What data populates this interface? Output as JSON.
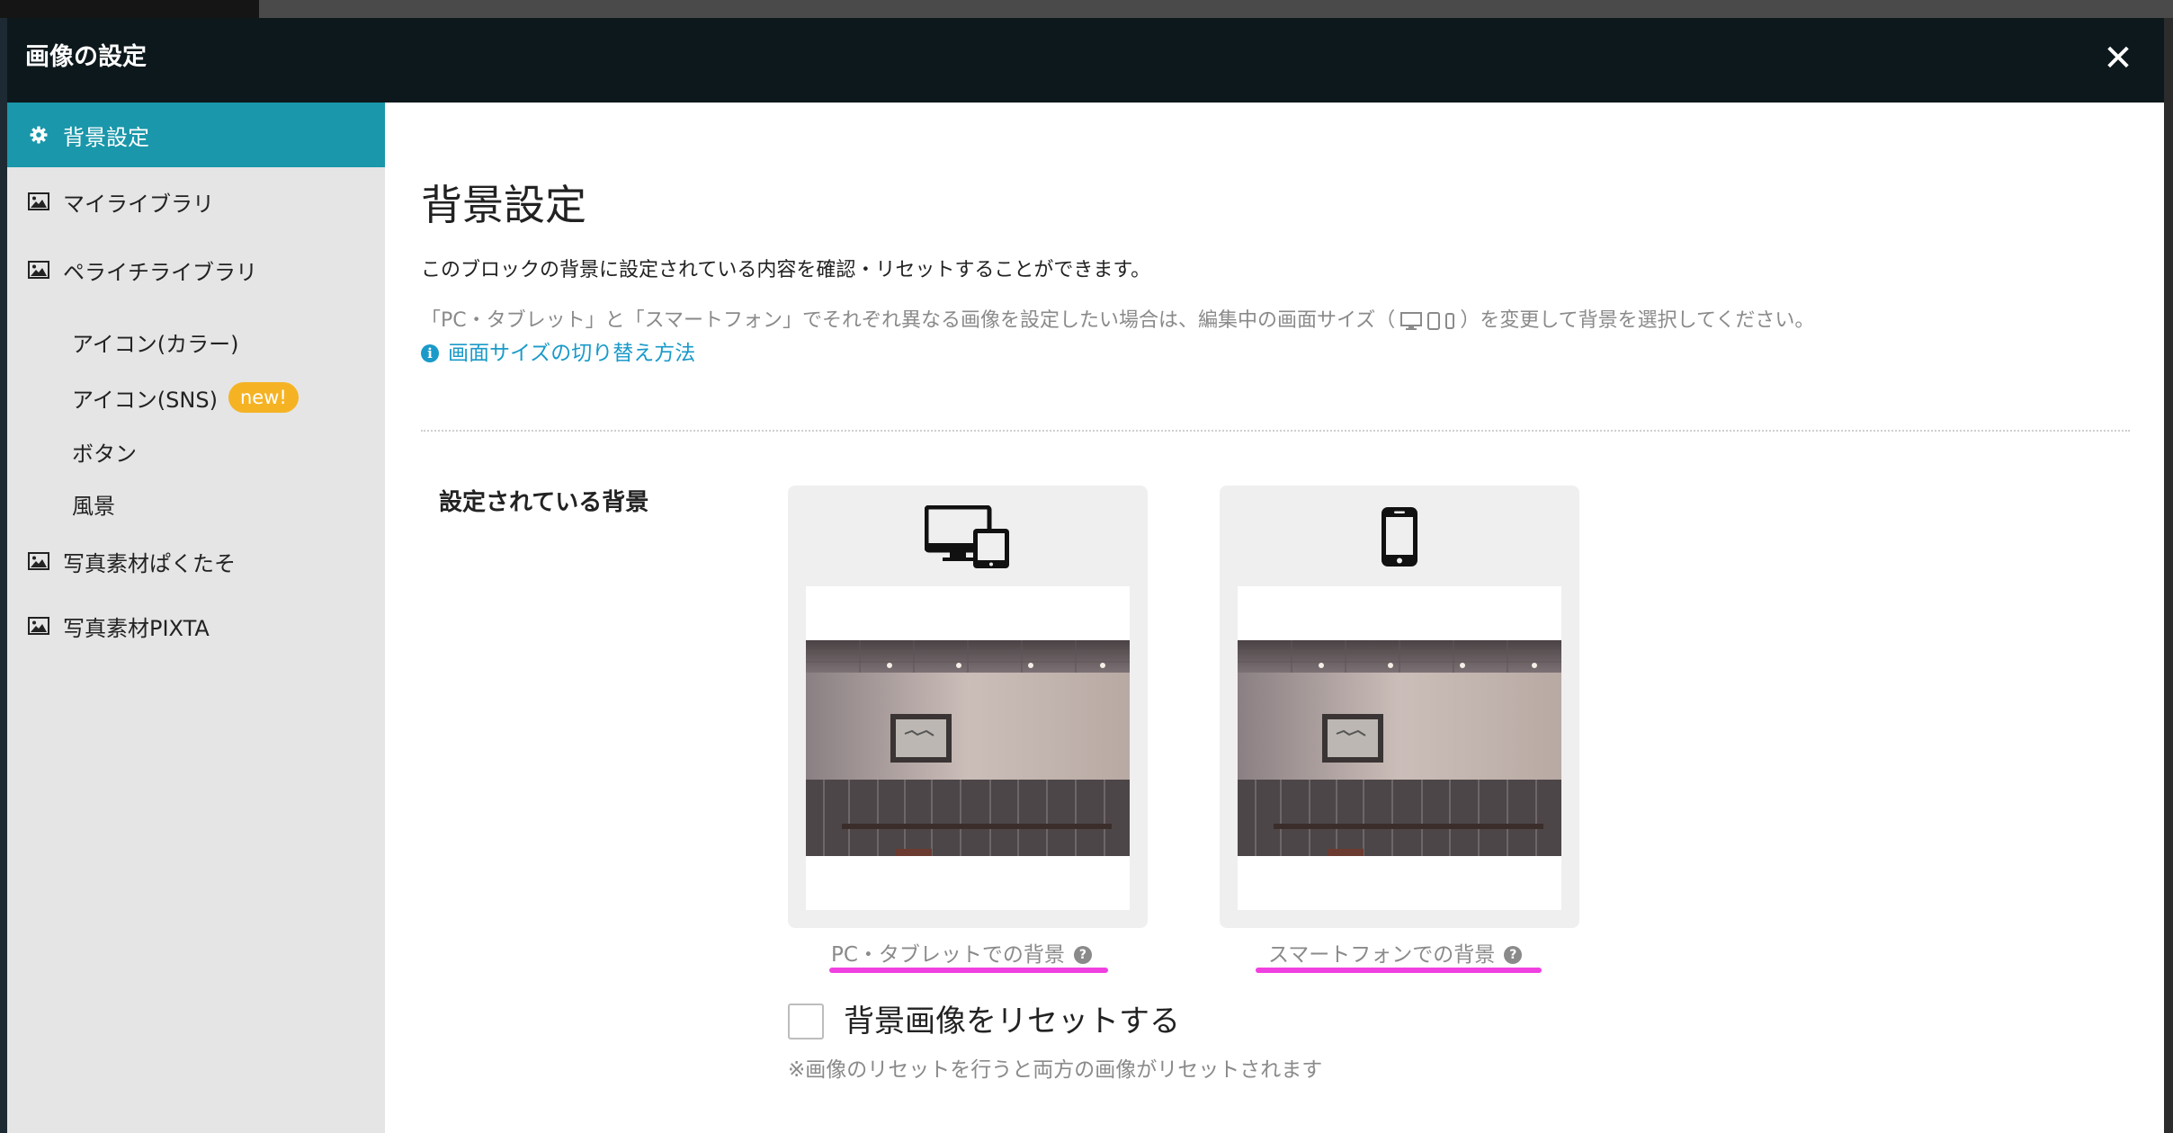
{
  "modal": {
    "title": "画像の設定",
    "close_label": "✕"
  },
  "sidebar": {
    "items": [
      {
        "label": "背景設定",
        "icon": "gear-icon",
        "active": true
      },
      {
        "label": "マイライブラリ",
        "icon": "image-icon"
      },
      {
        "label": "ペライチライブラリ",
        "icon": "image-icon"
      },
      {
        "label": "写真素材ぱくたそ",
        "icon": "image-icon"
      },
      {
        "label": "写真素材PIXTA",
        "icon": "image-icon"
      }
    ],
    "subitems": [
      {
        "label": "アイコン(カラー)"
      },
      {
        "label": "アイコン(SNS)",
        "badge": "new!"
      },
      {
        "label": "ボタン"
      },
      {
        "label": "風景"
      }
    ]
  },
  "main": {
    "title": "背景設定",
    "description": "このブロックの背景に設定されている内容を確認・リセットすることができます。",
    "note_prefix": "「PC・タブレット」と「スマートフォン」でそれぞれ異なる画像を設定したい場合は、編集中の画面サイズ（",
    "note_suffix": "）を変更して背景を選択してください。",
    "help_link": "画面サイズの切り替え方法",
    "section_label": "設定されている背景",
    "cards": {
      "pc_caption": "PC・タブレットでの背景",
      "sp_caption": "スマートフォンでの背景"
    },
    "reset_label": "背景画像をリセットする",
    "reset_note": "※画像のリセットを行うと両方の画像がリセットされます"
  },
  "colors": {
    "header_bg": "#0c181c",
    "accent": "#1a97aa",
    "link": "#1a9ac9",
    "badge": "#f5b324",
    "highlight": "#f040e0"
  }
}
